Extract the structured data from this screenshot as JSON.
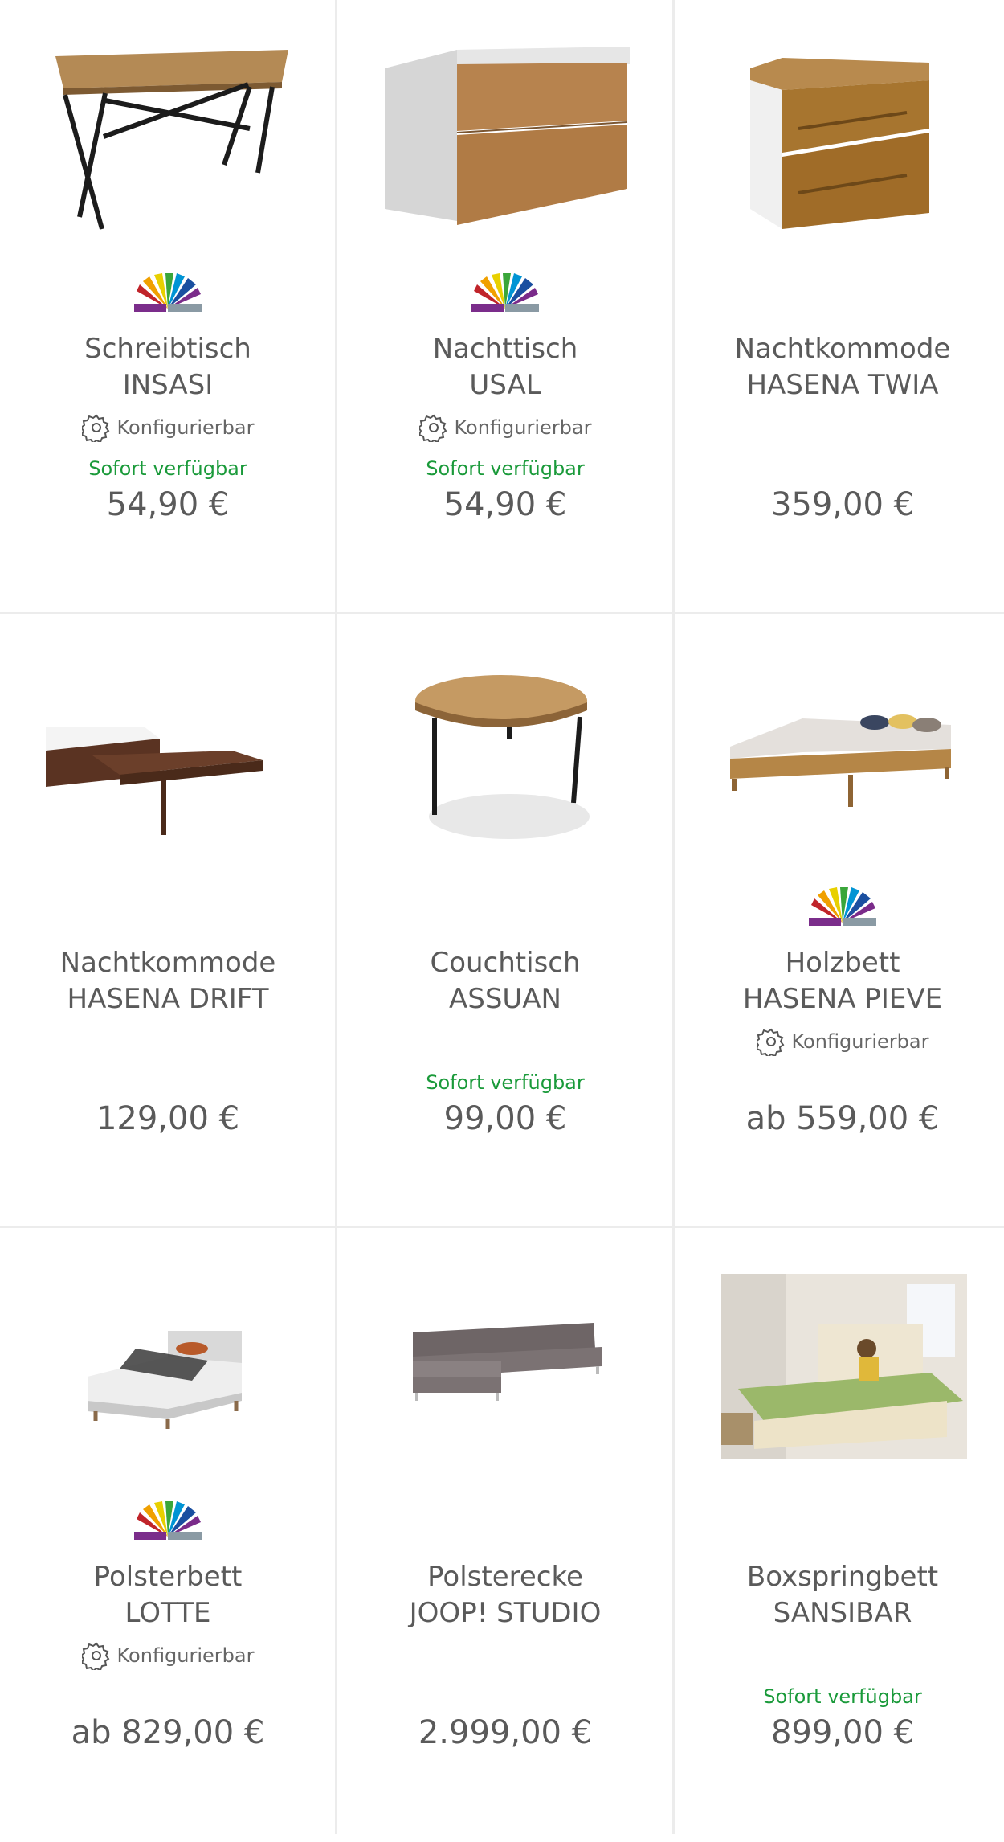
{
  "colors": {
    "available": "#1a9a3a",
    "text": "#5a5a5a",
    "divider": "#ececec"
  },
  "products": [
    {
      "line1": "Schreibtisch",
      "line2": "INSASI",
      "config": "Konfigurierbar",
      "availability": "Sofort verfügbar",
      "price": "54,90 €",
      "image": "desk-icon",
      "has_swatch": true
    },
    {
      "line1": "Nachttisch",
      "line2": "USAL",
      "config": "Konfigurierbar",
      "availability": "Sofort verfügbar",
      "price": "54,90 €",
      "image": "nightstand-white-icon",
      "has_swatch": true
    },
    {
      "line1": "Nachtkommode",
      "line2": "HASENA TWIA",
      "config": "",
      "availability": "",
      "price": "359,00 €",
      "image": "nightstand-wood-icon",
      "has_swatch": false
    },
    {
      "line1": "Nachtkommode",
      "line2": "HASENA DRIFT",
      "config": "",
      "availability": "",
      "price": "129,00 €",
      "image": "bedside-shelf-icon",
      "has_swatch": false
    },
    {
      "line1": "Couchtisch",
      "line2": "ASSUAN",
      "config": "",
      "availability": "Sofort verfügbar",
      "price": "99,00 €",
      "image": "coffee-table-icon",
      "has_swatch": false
    },
    {
      "line1": "Holzbett",
      "line2": "HASENA PIEVE",
      "config": "Konfigurierbar",
      "availability": "",
      "price": "ab 559,00 €",
      "image": "wood-bed-icon",
      "has_swatch": true
    },
    {
      "line1": "Polsterbett",
      "line2": "LOTTE",
      "config": "Konfigurierbar",
      "availability": "",
      "price": "ab 829,00 €",
      "image": "upholstered-bed-icon",
      "has_swatch": true
    },
    {
      "line1": "Polsterecke",
      "line2": "JOOP! STUDIO",
      "config": "",
      "availability": "",
      "price": "2.999,00 €",
      "image": "corner-sofa-icon",
      "has_swatch": false
    },
    {
      "line1": "Boxspringbett",
      "line2": "SANSIBAR",
      "config": "",
      "availability": "Sofort verfügbar",
      "price": "899,00 €",
      "image": "boxspring-bed-photo",
      "has_swatch": false
    }
  ]
}
